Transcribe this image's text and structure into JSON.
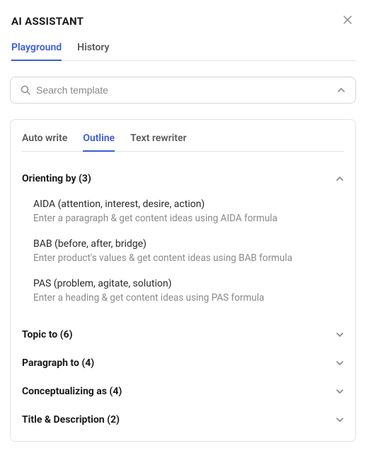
{
  "header": {
    "title": "AI ASSISTANT"
  },
  "nav": {
    "tabs": [
      {
        "label": "Playground",
        "active": true
      },
      {
        "label": "History",
        "active": false
      }
    ]
  },
  "search": {
    "placeholder": "Search template",
    "value": ""
  },
  "panel": {
    "tabs": [
      {
        "label": "Auto write",
        "active": false
      },
      {
        "label": "Outline",
        "active": true
      },
      {
        "label": "Text rewriter",
        "active": false
      }
    ],
    "sections": [
      {
        "title": "Orienting by (3)",
        "expanded": true,
        "items": [
          {
            "title": "AIDA (attention, interest, desire, action)",
            "desc": "Enter a paragraph & get content ideas using AIDA formula"
          },
          {
            "title": "BAB (before, after, bridge)",
            "desc": "Enter product's values & get content ideas using BAB formula"
          },
          {
            "title": "PAS (problem, agitate, solution)",
            "desc": "Enter a heading & get content ideas using PAS formula"
          }
        ]
      },
      {
        "title": "Topic to (6)",
        "expanded": false,
        "items": []
      },
      {
        "title": "Paragraph to (4)",
        "expanded": false,
        "items": []
      },
      {
        "title": "Conceptualizing as (4)",
        "expanded": false,
        "items": []
      },
      {
        "title": "Title & Description (2)",
        "expanded": false,
        "items": []
      }
    ]
  }
}
